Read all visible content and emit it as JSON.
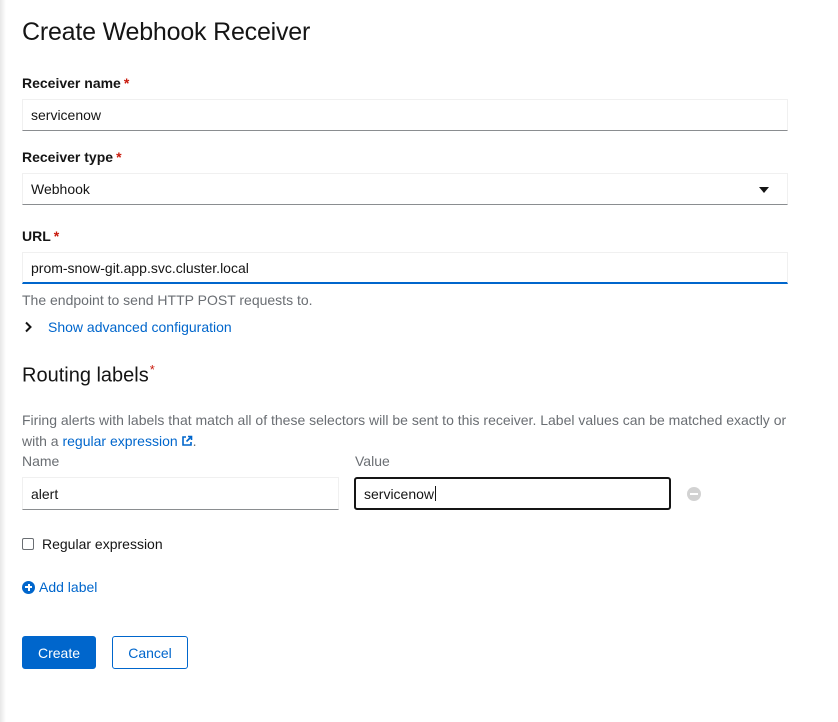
{
  "page": {
    "title": "Create Webhook Receiver"
  },
  "form": {
    "receiver_name": {
      "label": "Receiver name",
      "required_mark": "*",
      "value": "servicenow"
    },
    "receiver_type": {
      "label": "Receiver type",
      "required_mark": "*",
      "value": "Webhook"
    },
    "url": {
      "label": "URL",
      "required_mark": "*",
      "value": "prom-snow-git.app.svc.cluster.local",
      "help": "The endpoint to send HTTP POST requests to."
    },
    "advanced_toggle": "Show advanced configuration"
  },
  "routing": {
    "title": "Routing labels",
    "required_mark": "*",
    "description_prefix": "Firing alerts with labels that match all of these selectors will be sent to this receiver. Label values can be matched exactly or with a ",
    "regex_link": "regular expression",
    "description_suffix": ".",
    "name_header": "Name",
    "value_header": "Value",
    "rows": [
      {
        "name": "alert",
        "value": "servicenow"
      }
    ],
    "regex_checkbox_label": "Regular expression",
    "regex_checked": false,
    "add_label": "Add label"
  },
  "actions": {
    "create": "Create",
    "cancel": "Cancel"
  },
  "colors": {
    "link": "#0066cc",
    "required": "#c9190b",
    "primary_button": "#0066cc",
    "muted_text": "#6a6e73"
  },
  "icons": {
    "select_caret": "caret-down-icon",
    "advanced_toggle": "angle-right-icon",
    "regex_link": "external-link-icon",
    "remove_row": "minus-circle-icon",
    "add_label": "plus-circle-icon"
  }
}
